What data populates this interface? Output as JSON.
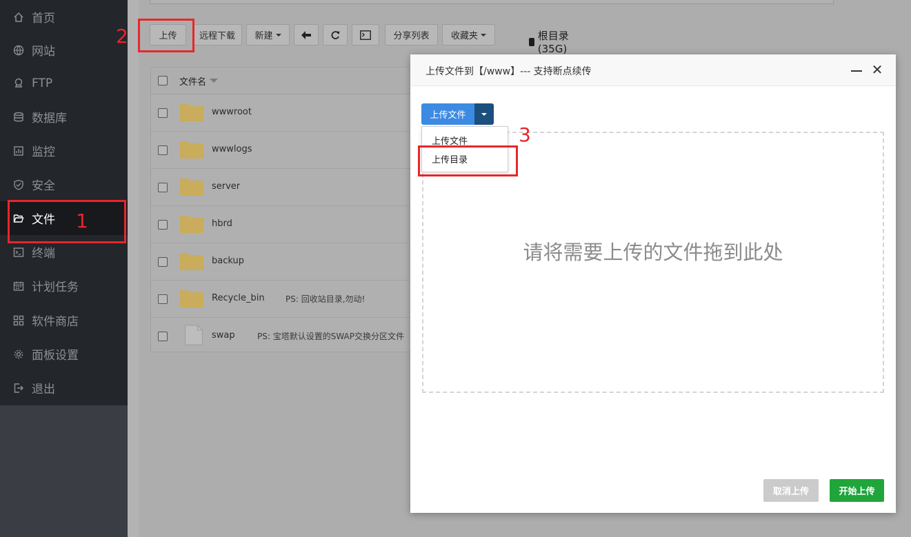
{
  "sidebar": {
    "items": [
      {
        "label": "首页",
        "icon": "home-icon"
      },
      {
        "label": "网站",
        "icon": "globe-icon"
      },
      {
        "label": "FTP",
        "icon": "ftp-icon"
      },
      {
        "label": "数据库",
        "icon": "database-icon"
      },
      {
        "label": "监控",
        "icon": "monitor-icon"
      },
      {
        "label": "安全",
        "icon": "shield-icon"
      },
      {
        "label": "文件",
        "icon": "folder-open-icon",
        "active": true
      },
      {
        "label": "终端",
        "icon": "terminal-icon"
      },
      {
        "label": "计划任务",
        "icon": "calendar-icon"
      },
      {
        "label": "软件商店",
        "icon": "apps-icon"
      },
      {
        "label": "面板设置",
        "icon": "gear-icon"
      },
      {
        "label": "退出",
        "icon": "logout-icon"
      }
    ]
  },
  "toolbar": {
    "upload": "上传",
    "remote_download": "远程下载",
    "new": "新建",
    "share_list": "分享列表",
    "favorites": "收藏夹",
    "disk": "根目录(35G)"
  },
  "table": {
    "header_name": "文件名",
    "rows": [
      {
        "name": "wwwroot",
        "type": "folder",
        "ps": ""
      },
      {
        "name": "wwwlogs",
        "type": "folder",
        "ps": ""
      },
      {
        "name": "server",
        "type": "folder",
        "ps": ""
      },
      {
        "name": "hbrd",
        "type": "folder",
        "ps": ""
      },
      {
        "name": "backup",
        "type": "folder",
        "ps": ""
      },
      {
        "name": "Recycle_bin",
        "type": "folder",
        "ps": "PS: 回收站目录,勿动!"
      },
      {
        "name": "swap",
        "type": "file",
        "ps": "PS: 宝塔默认设置的SWAP交换分区文件"
      }
    ]
  },
  "modal": {
    "title": "上传文件到【/www】--- 支持断点续传",
    "upload_button": "上传文件",
    "dropdown": [
      "上传文件",
      "上传目录"
    ],
    "drop_hint": "请将需要上传的文件拖到此处",
    "cancel": "取消上传",
    "start": "开始上传"
  },
  "annotations": {
    "n1": "1",
    "n2": "2",
    "n3": "3",
    "color": "#e8262b"
  },
  "colors": {
    "primary_blue": "#3d8ae3",
    "green": "#20a53a",
    "sidebar_bg": "#23262b"
  }
}
